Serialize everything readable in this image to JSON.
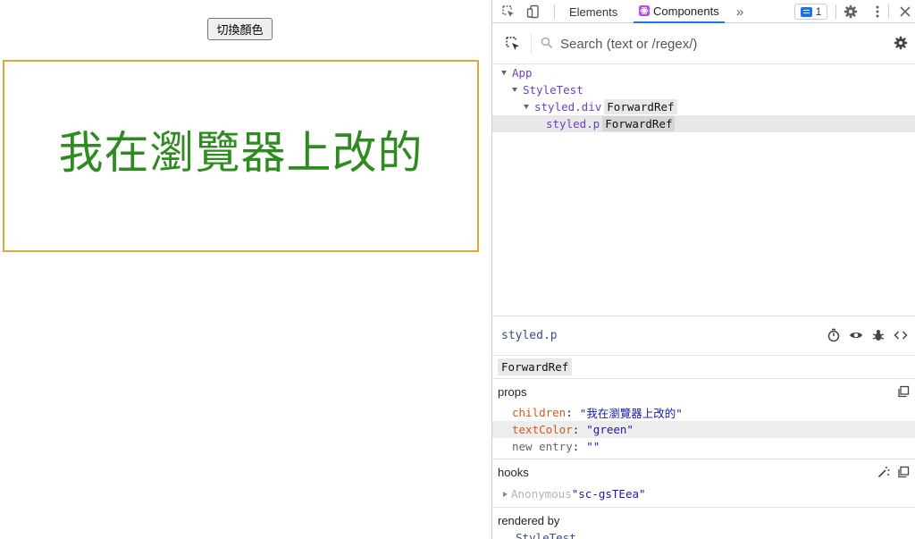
{
  "page": {
    "toggle_button": "切換顏色",
    "styled_text": "我在瀏覽器上改的",
    "text_color": "#2e8b20",
    "border_color": "#dfa838"
  },
  "devtools": {
    "tabs": {
      "elements": "Elements",
      "components": "Components",
      "more": "»",
      "issues_count": "1"
    },
    "search_placeholder": "Search (text or /regex/)",
    "tree": [
      {
        "name": "App",
        "badge": ""
      },
      {
        "name": "StyleTest",
        "badge": ""
      },
      {
        "name": "styled.div",
        "badge": "ForwardRef"
      },
      {
        "name": "styled.p",
        "badge": "ForwardRef"
      }
    ],
    "inspector": {
      "title": "styled.p",
      "badge": "ForwardRef",
      "props_title": "props",
      "props": [
        {
          "key": "children",
          "value": "\"我在瀏覽器上改的\""
        },
        {
          "key": "textColor",
          "value": "\"green\""
        },
        {
          "key": "new entry",
          "value": "\"\""
        }
      ],
      "hooks_title": "hooks",
      "hook_name": "Anonymous",
      "hook_value": "\"sc-gsTEea\"",
      "rendered_title": "rendered by",
      "rendered_item": "StyleTest"
    },
    "accent_color": "#1a73e8",
    "component_color": "#6d3fc7"
  }
}
